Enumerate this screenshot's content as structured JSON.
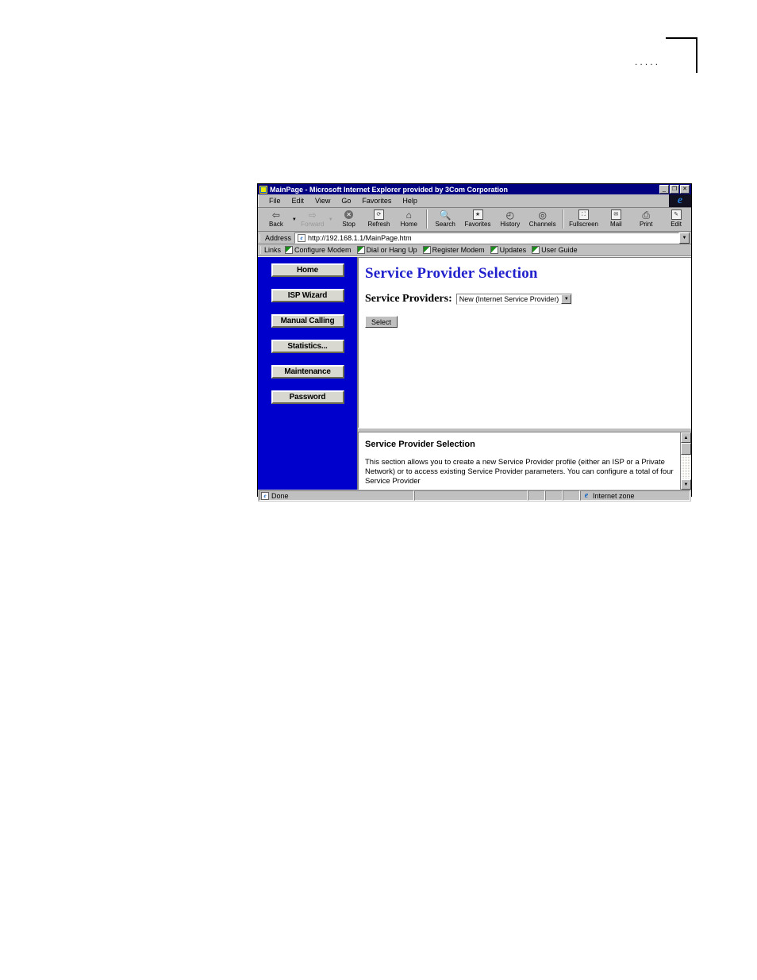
{
  "window": {
    "title": "MainPage - Microsoft Internet Explorer provided by 3Com Corporation",
    "minimize_label": "_",
    "restore_label": "❐",
    "close_label": "✕"
  },
  "menu": {
    "items": [
      "File",
      "Edit",
      "View",
      "Go",
      "Favorites",
      "Help"
    ]
  },
  "toolbar": {
    "buttons": [
      {
        "label": "Back",
        "icon": "back-arrow-icon",
        "glyph": "⇦",
        "disabled": false,
        "dropdown": true
      },
      {
        "label": "Forward",
        "icon": "forward-arrow-icon",
        "glyph": "⇨",
        "disabled": true,
        "dropdown": true
      },
      {
        "label": "Stop",
        "icon": "stop-icon",
        "glyph": "✕",
        "disabled": false,
        "dropdown": false
      },
      {
        "label": "Refresh",
        "icon": "refresh-icon",
        "glyph": "⟳",
        "disabled": false,
        "dropdown": false
      },
      {
        "label": "Home",
        "icon": "home-icon",
        "glyph": "⌂",
        "disabled": false,
        "dropdown": false
      },
      {
        "label": "Search",
        "icon": "search-icon",
        "glyph": "🔍",
        "disabled": false,
        "dropdown": false
      },
      {
        "label": "Favorites",
        "icon": "favorites-icon",
        "glyph": "★",
        "disabled": false,
        "dropdown": false
      },
      {
        "label": "History",
        "icon": "history-icon",
        "glyph": "◴",
        "disabled": false,
        "dropdown": false
      },
      {
        "label": "Channels",
        "icon": "channels-icon",
        "glyph": "◎",
        "disabled": false,
        "dropdown": false
      },
      {
        "label": "Fullscreen",
        "icon": "fullscreen-icon",
        "glyph": "⛶",
        "disabled": false,
        "dropdown": false
      },
      {
        "label": "Mail",
        "icon": "mail-icon",
        "glyph": "✉",
        "disabled": false,
        "dropdown": false
      },
      {
        "label": "Print",
        "icon": "print-icon",
        "glyph": "⎙",
        "disabled": false,
        "dropdown": false
      },
      {
        "label": "Edit",
        "icon": "edit-icon",
        "glyph": "✎",
        "disabled": false,
        "dropdown": false
      }
    ],
    "ie_logo": "e"
  },
  "address": {
    "label": "Address",
    "url": "http://192.168.1.1/MainPage.htm",
    "placeholder": "http://",
    "icon": "page-icon",
    "dropdown_glyph": "▼"
  },
  "links": {
    "label": "Links",
    "items": [
      {
        "label": "Configure Modem",
        "icon": "link-folder-icon"
      },
      {
        "label": "Dial or Hang Up",
        "icon": "link-folder-icon"
      },
      {
        "label": "Register Modem",
        "icon": "link-folder-icon"
      },
      {
        "label": "Updates",
        "icon": "link-folder-icon"
      },
      {
        "label": "User Guide",
        "icon": "link-folder-icon"
      }
    ]
  },
  "nav": {
    "items": [
      {
        "label": "Home"
      },
      {
        "label": "ISP Wizard"
      },
      {
        "label": "Manual Calling"
      },
      {
        "label": "Statistics..."
      },
      {
        "label": "Maintenance"
      },
      {
        "label": "Password"
      }
    ],
    "background_color": "#0000cc"
  },
  "main": {
    "heading": "Service Provider Selection",
    "heading_color": "#2020cc",
    "field_label": "Service Providers:",
    "selected_provider": "New (Internet Service Provider)",
    "provider_options": [
      "New (Internet Service Provider)"
    ],
    "select_button": "Select",
    "dropdown_glyph": "▼"
  },
  "help": {
    "title": "Service Provider Selection",
    "text": "This section allows you to create a new Service Provider profile (either an ISP or a Private Network) or to access existing Service Provider parameters. You can configure a total of four Service Provider",
    "scroll_up_glyph": "▲",
    "scroll_down_glyph": "▼"
  },
  "status": {
    "message": "Done",
    "zone": "Internet zone",
    "doc_icon": "page-icon",
    "zone_icon": "internet-zone-icon"
  },
  "corner": {
    "dots": "·····"
  }
}
